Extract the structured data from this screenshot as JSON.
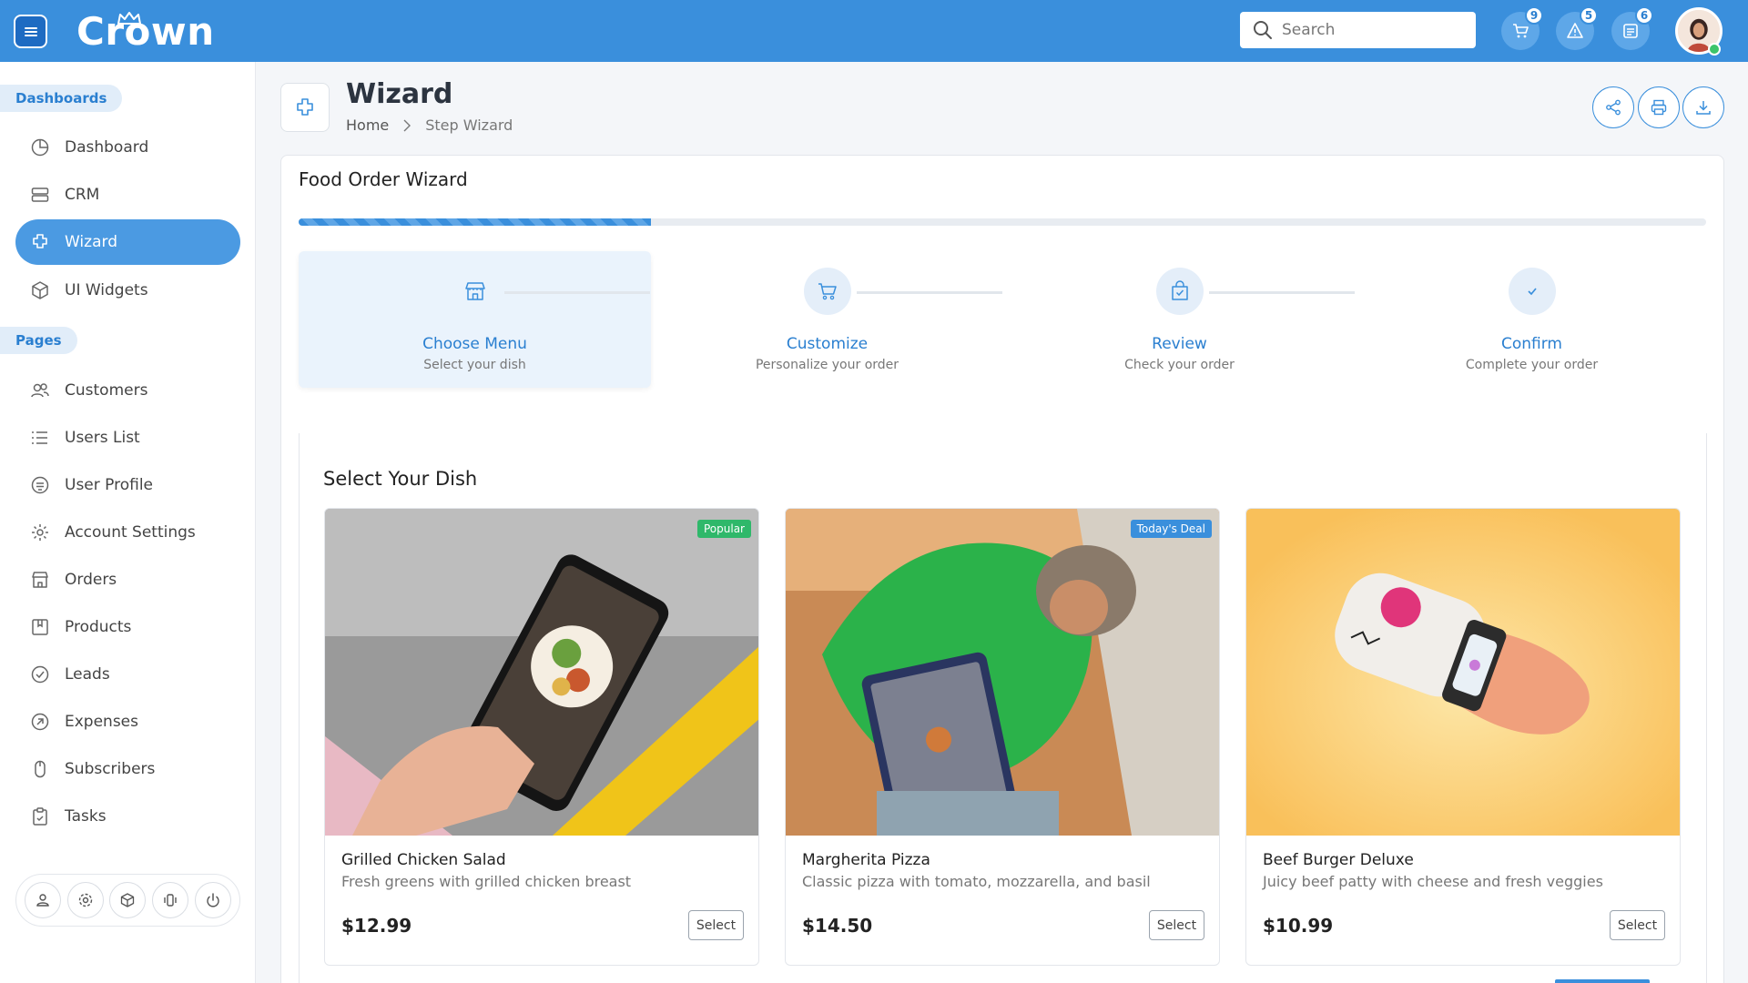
{
  "app": {
    "logo": "Crown",
    "search_placeholder": "Search",
    "notifications": [
      {
        "icon": "cart-icon",
        "count": "9"
      },
      {
        "icon": "alert-icon",
        "count": "5"
      },
      {
        "icon": "document-icon",
        "count": "6"
      }
    ],
    "accent_color": "#3a8fdc"
  },
  "sidebar": {
    "sections": [
      {
        "label": "Dashboards"
      },
      {
        "label": "Pages"
      }
    ],
    "items": [
      {
        "label": "Dashboard",
        "icon": "pie-chart-icon"
      },
      {
        "label": "CRM",
        "icon": "server-icon"
      },
      {
        "label": "Wizard",
        "icon": "puzzle-icon",
        "active": true
      },
      {
        "label": "UI Widgets",
        "icon": "cube-icon"
      },
      {
        "label": "Customers",
        "icon": "users-icon"
      },
      {
        "label": "Users List",
        "icon": "list-icon"
      },
      {
        "label": "User Profile",
        "icon": "profile-icon"
      },
      {
        "label": "Account Settings",
        "icon": "gear-icon"
      },
      {
        "label": "Orders",
        "icon": "store-icon"
      },
      {
        "label": "Products",
        "icon": "box-icon"
      },
      {
        "label": "Leads",
        "icon": "check-circle-icon"
      },
      {
        "label": "Expenses",
        "icon": "arrow-circle-icon"
      },
      {
        "label": "Subscribers",
        "icon": "mouse-icon"
      },
      {
        "label": "Tasks",
        "icon": "clipboard-icon"
      }
    ],
    "footer_icons": [
      "user-icon",
      "gear-icon",
      "cube-icon",
      "vibrate-icon",
      "power-icon"
    ]
  },
  "page": {
    "title": "Wizard",
    "breadcrumb": [
      "Home",
      "Step Wizard"
    ],
    "actions": [
      "share-icon",
      "print-icon",
      "download-icon"
    ]
  },
  "wizard": {
    "title": "Food Order Wizard",
    "progress_fraction": 0.25,
    "steps": [
      {
        "label": "Choose Menu",
        "sub": "Select your dish",
        "icon": "store-icon",
        "active": true
      },
      {
        "label": "Customize",
        "sub": "Personalize your order",
        "icon": "cart-icon"
      },
      {
        "label": "Review",
        "sub": "Check your order",
        "icon": "bag-check-icon"
      },
      {
        "label": "Confirm",
        "sub": "Complete your order",
        "icon": "check-icon"
      }
    ],
    "section_title": "Select Your Dish",
    "dishes": [
      {
        "name": "Grilled Chicken Salad",
        "desc": "Fresh greens with grilled chicken breast",
        "price": "$12.99",
        "tag": "Popular",
        "tag_color": "#2fb86a",
        "button": "Select"
      },
      {
        "name": "Margherita Pizza",
        "desc": "Classic pizza with tomato, mozzarella, and basil",
        "price": "$14.50",
        "tag": "Today's Deal",
        "tag_color": "#3a8fdc",
        "button": "Select"
      },
      {
        "name": "Beef Burger Deluxe",
        "desc": "Juicy beef patty with cheese and fresh veggies",
        "price": "$10.99",
        "tag": "",
        "button": "Select"
      }
    ]
  }
}
